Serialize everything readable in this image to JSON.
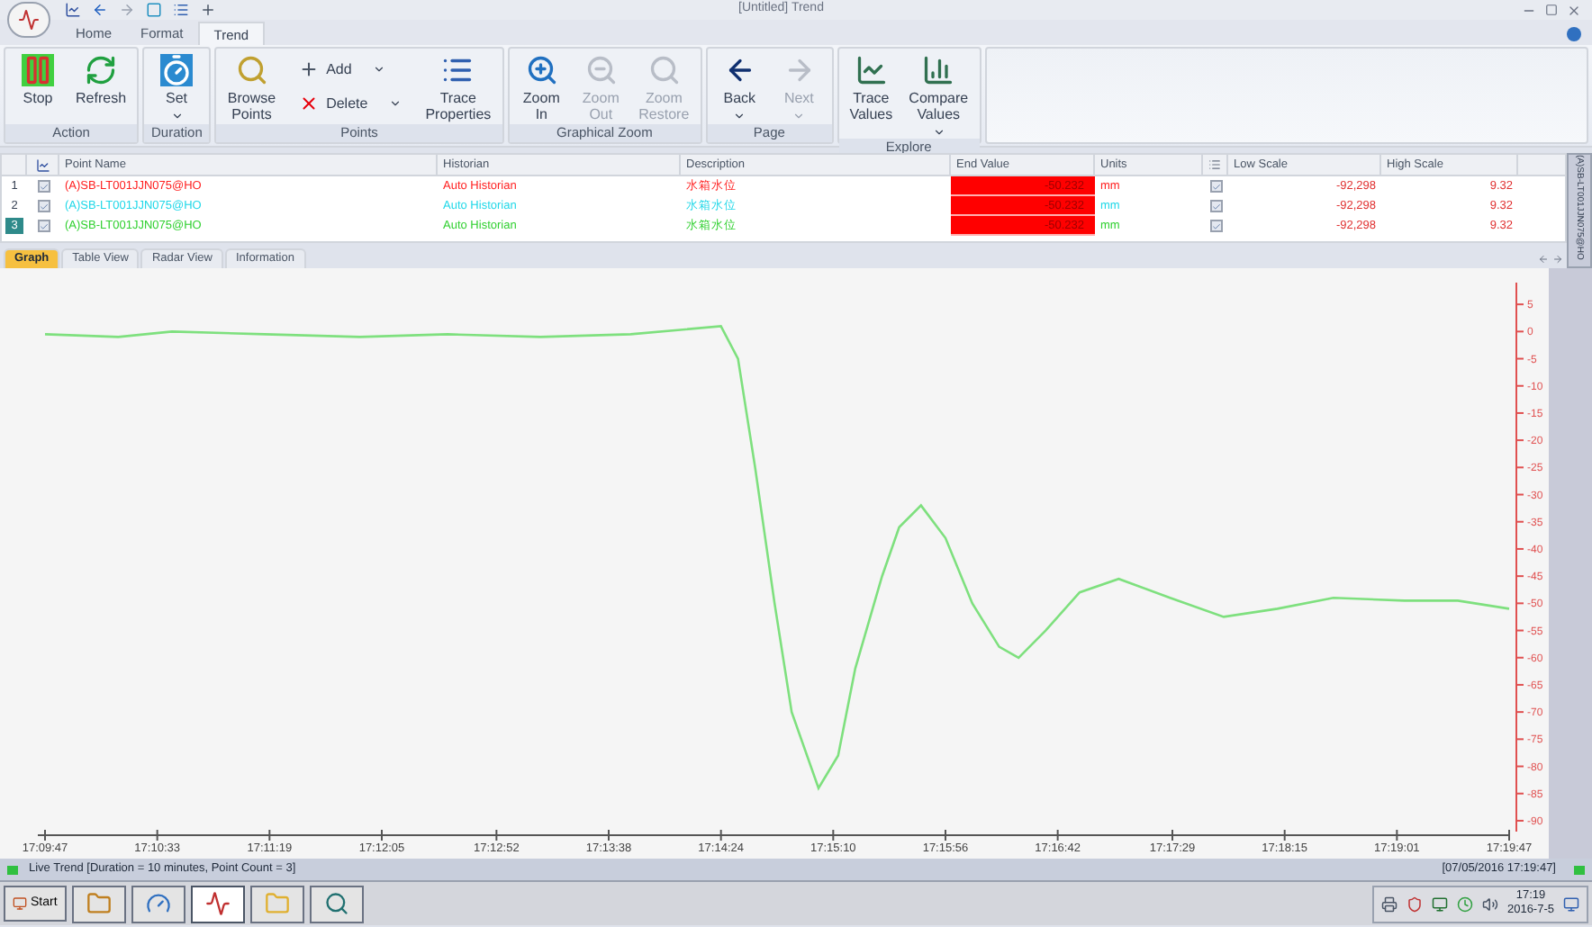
{
  "window": {
    "title": "[Untitled] Trend"
  },
  "ribbon_tabs": [
    {
      "label": "Home",
      "selected": false
    },
    {
      "label": "Format",
      "selected": false
    },
    {
      "label": "Trend",
      "selected": true
    }
  ],
  "ribbon_groups": [
    {
      "label": "Action",
      "buttons": [
        {
          "label": "Stop",
          "disabled": false
        },
        {
          "label": "Refresh",
          "disabled": false
        }
      ]
    },
    {
      "label": "Duration",
      "buttons": [
        {
          "label": "Set",
          "disabled": false,
          "dropdown": true
        }
      ]
    },
    {
      "label": "Points",
      "buttons": [
        {
          "label": "Browse Points",
          "disabled": false
        },
        {
          "kind": "stack",
          "items": [
            {
              "label": "Add"
            },
            {
              "label": "Delete"
            }
          ]
        },
        {
          "label": "Trace Properties",
          "disabled": false
        }
      ]
    },
    {
      "label": "Graphical Zoom",
      "buttons": [
        {
          "label": "Zoom In",
          "disabled": false
        },
        {
          "label": "Zoom Out",
          "disabled": true
        },
        {
          "label": "Zoom Restore",
          "disabled": true
        }
      ]
    },
    {
      "label": "Page",
      "buttons": [
        {
          "label": "Back",
          "disabled": false,
          "dropdown": true
        },
        {
          "label": "Next",
          "disabled": true,
          "dropdown": true
        }
      ]
    },
    {
      "label": "Explore",
      "buttons": [
        {
          "label": "Trace Values",
          "disabled": false
        },
        {
          "label": "Compare Values",
          "disabled": false,
          "dropdown": true
        }
      ]
    }
  ],
  "table": {
    "columns": [
      "Point Name",
      "Historian",
      "Description",
      "End Value",
      "Units",
      "Low Scale",
      "High Scale"
    ],
    "rows": [
      {
        "index": "1",
        "checked": true,
        "selected": false,
        "color": "#ff2020",
        "point_name": "(A)SB-LT001JJN075@HO",
        "historian": "Auto Historian",
        "description": "水箱水位",
        "end_value": "-50.232",
        "units": "mm",
        "scale_checked": true,
        "low_scale": "-92,298",
        "high_scale": "9.32"
      },
      {
        "index": "2",
        "checked": true,
        "selected": false,
        "color": "#20d8e8",
        "point_name": "(A)SB-LT001JJN075@HO",
        "historian": "Auto Historian",
        "description": "水箱水位",
        "end_value": "-50.232",
        "units": "mm",
        "scale_checked": true,
        "low_scale": "-92,298",
        "high_scale": "9.32"
      },
      {
        "index": "3",
        "checked": true,
        "selected": true,
        "color": "#30d030",
        "point_name": "(A)SB-LT001JJN075@HO",
        "historian": "Auto Historian",
        "description": "水箱水位",
        "end_value": "-50.232",
        "units": "mm",
        "scale_checked": true,
        "low_scale": "-92,298",
        "high_scale": "9.32"
      }
    ]
  },
  "side_panel": {
    "label": "(A)SB-LT001JJN075@HO"
  },
  "view_tabs": [
    {
      "label": "Graph",
      "selected": true
    },
    {
      "label": "Table View",
      "selected": false
    },
    {
      "label": "Radar View",
      "selected": false
    },
    {
      "label": "Information",
      "selected": false
    }
  ],
  "chart": {
    "chart_data": {
      "type": "line",
      "xlim": [
        61787,
        62387
      ],
      "ylim": [
        -92,
        9
      ],
      "x": [
        61787,
        61817,
        61839,
        61877,
        61916,
        61952,
        61990,
        62027,
        62064,
        62071,
        62078,
        62086,
        62093,
        62104,
        62112,
        62119,
        62130,
        62137,
        62146,
        62156,
        62167,
        62178,
        62186,
        62197,
        62211,
        62227,
        62248,
        62270,
        62292,
        62315,
        62344,
        62366,
        62387
      ],
      "series": [
        {
          "color": "#7ee07e",
          "values": [
            -0.5,
            -1,
            0,
            -0.5,
            -1,
            -0.5,
            -1,
            -0.5,
            1,
            -5,
            -25,
            -50,
            -70,
            -84,
            -78,
            -62,
            -45,
            -36,
            -32,
            -38,
            -50,
            -58,
            -60,
            -55,
            -48,
            -45.5,
            -49,
            -52.5,
            -51,
            -49,
            -49.5,
            -49.5,
            -51
          ]
        }
      ],
      "xticks": [
        {
          "value": 61787,
          "label": "17:09:47"
        },
        {
          "value": 61833,
          "label": "17:10:33"
        },
        {
          "value": 61879,
          "label": "17:11:19"
        },
        {
          "value": 61925,
          "label": "17:12:05"
        },
        {
          "value": 61972,
          "label": "17:12:52"
        },
        {
          "value": 62018,
          "label": "17:13:38"
        },
        {
          "value": 62064,
          "label": "17:14:24"
        },
        {
          "value": 62110,
          "label": "17:15:10"
        },
        {
          "value": 62156,
          "label": "17:15:56"
        },
        {
          "value": 62202,
          "label": "17:16:42"
        },
        {
          "value": 62249,
          "label": "17:17:29"
        },
        {
          "value": 62295,
          "label": "17:18:15"
        },
        {
          "value": 62341,
          "label": "17:19:01"
        },
        {
          "value": 62387,
          "label": "17:19:47"
        }
      ],
      "yticks": [
        5,
        0,
        -5,
        -10,
        -15,
        -20,
        -25,
        -30,
        -35,
        -40,
        -45,
        -50,
        -55,
        -60,
        -65,
        -70,
        -75,
        -80,
        -85,
        -90
      ]
    }
  },
  "status_bar": {
    "text": "Live Trend [Duration = 10 minutes, Point Count = 3]",
    "timestamp": "[07/05/2016 17:19:47]"
  },
  "taskbar": {
    "start": "Start",
    "apps": [
      {
        "selected": false
      },
      {
        "selected": false
      },
      {
        "selected": true
      },
      {
        "selected": false
      },
      {
        "selected": false
      }
    ],
    "time": "17:19",
    "date": "2016-7-5"
  }
}
